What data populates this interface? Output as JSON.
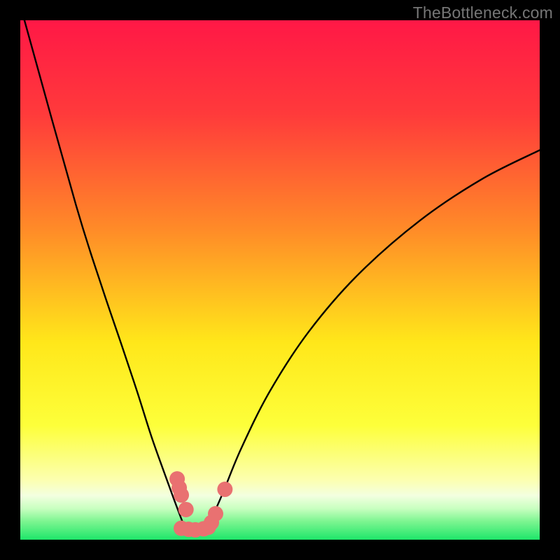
{
  "watermark": "TheBottleneck.com",
  "chart_data": {
    "type": "line",
    "title": "",
    "xlabel": "",
    "ylabel": "",
    "xlim": [
      0,
      100
    ],
    "ylim": [
      0,
      100
    ],
    "gradient_stops": [
      {
        "offset": 0,
        "color": "#ff1846"
      },
      {
        "offset": 0.18,
        "color": "#ff3a3b"
      },
      {
        "offset": 0.4,
        "color": "#ff8a28"
      },
      {
        "offset": 0.62,
        "color": "#ffe71a"
      },
      {
        "offset": 0.78,
        "color": "#fdff3a"
      },
      {
        "offset": 0.885,
        "color": "#fcffb0"
      },
      {
        "offset": 0.915,
        "color": "#f3ffe0"
      },
      {
        "offset": 0.94,
        "color": "#c8ffc0"
      },
      {
        "offset": 0.965,
        "color": "#7cf590"
      },
      {
        "offset": 1.0,
        "color": "#1ee66a"
      }
    ],
    "series": [
      {
        "name": "left-curve",
        "x": [
          0.8,
          10.7,
          15.6,
          19.5,
          22.5,
          25.2,
          27.5,
          29.5,
          31.2
        ],
        "y": [
          100,
          64.5,
          49.0,
          37.5,
          28.5,
          20.0,
          13.5,
          8.0,
          3.5
        ]
      },
      {
        "name": "right-curve",
        "x": [
          36.5,
          39.0,
          42.5,
          48.0,
          55.5,
          65.0,
          77.0,
          89.0,
          100.0
        ],
        "y": [
          3.3,
          9.0,
          17.5,
          28.5,
          40.0,
          51.0,
          61.5,
          69.5,
          75.0
        ]
      }
    ],
    "valley_markers": {
      "left_cluster": [
        {
          "x": 30.2,
          "y": 11.7
        },
        {
          "x": 30.6,
          "y": 10.0
        },
        {
          "x": 31.0,
          "y": 8.6
        },
        {
          "x": 31.9,
          "y": 5.8
        }
      ],
      "floor": [
        {
          "x": 31.0,
          "y": 2.2
        },
        {
          "x": 32.4,
          "y": 2.0
        },
        {
          "x": 33.7,
          "y": 1.9
        },
        {
          "x": 35.3,
          "y": 2.1
        },
        {
          "x": 36.2,
          "y": 2.4
        },
        {
          "x": 36.8,
          "y": 3.3
        }
      ],
      "right_cluster": [
        {
          "x": 37.6,
          "y": 5.0
        },
        {
          "x": 39.4,
          "y": 9.7
        }
      ]
    },
    "curve_color": "#000000",
    "marker_color": "#e97171",
    "marker_radius_px": 11
  }
}
